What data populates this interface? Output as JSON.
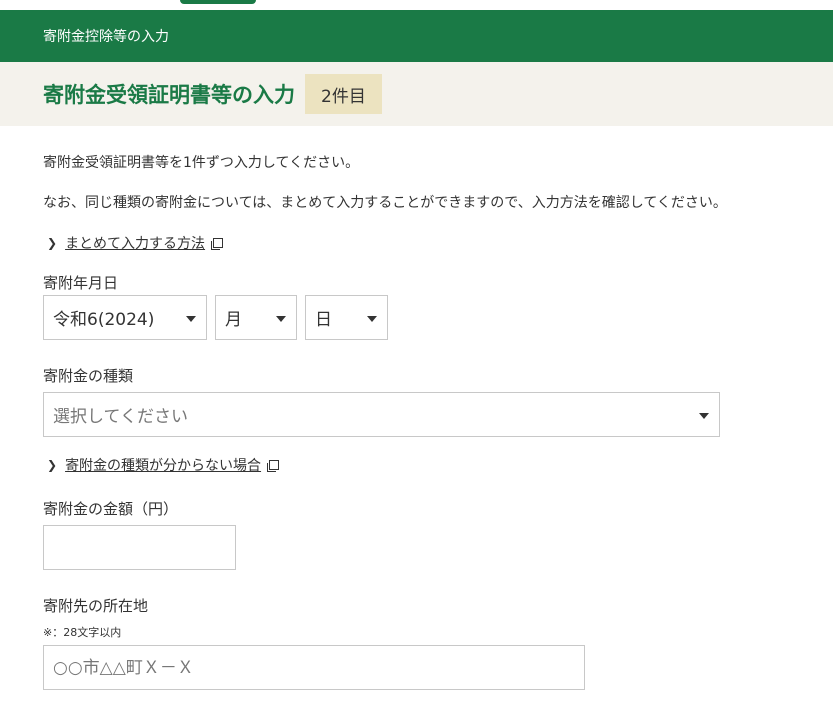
{
  "header": {
    "section_title": "寄附金控除等の入力"
  },
  "title_band": {
    "title": "寄附金受領証明書等の入力",
    "count_badge": "2件目"
  },
  "intro": {
    "line1": "寄附金受領証明書等を1件ずつ入力してください。",
    "line2": "なお、同じ種類の寄附金については、まとめて入力することができますので、入力方法を確認してください。",
    "link_label": "まとめて入力する方法"
  },
  "date_field": {
    "label": "寄附年月日",
    "year_value": "令和6(2024)",
    "month_value": "月",
    "day_value": "日"
  },
  "type_field": {
    "label": "寄附金の種類",
    "value": "選択してください",
    "help_link": "寄附金の種類が分からない場合"
  },
  "amount_field": {
    "label": "寄附金の金額（円）",
    "value": ""
  },
  "address_field": {
    "label": "寄附先の所在地",
    "note": "※：28文字以内",
    "placeholder": "○○市△△町Ｘ－Ｘ"
  },
  "icons": {
    "chevron": "chevron-right-icon",
    "external": "external-window-icon",
    "dropdown": "dropdown-caret-icon"
  },
  "colors": {
    "header_green": "#1a7a46",
    "title_band_bg": "#f4f2ec",
    "badge_bg": "#ece3c0"
  }
}
